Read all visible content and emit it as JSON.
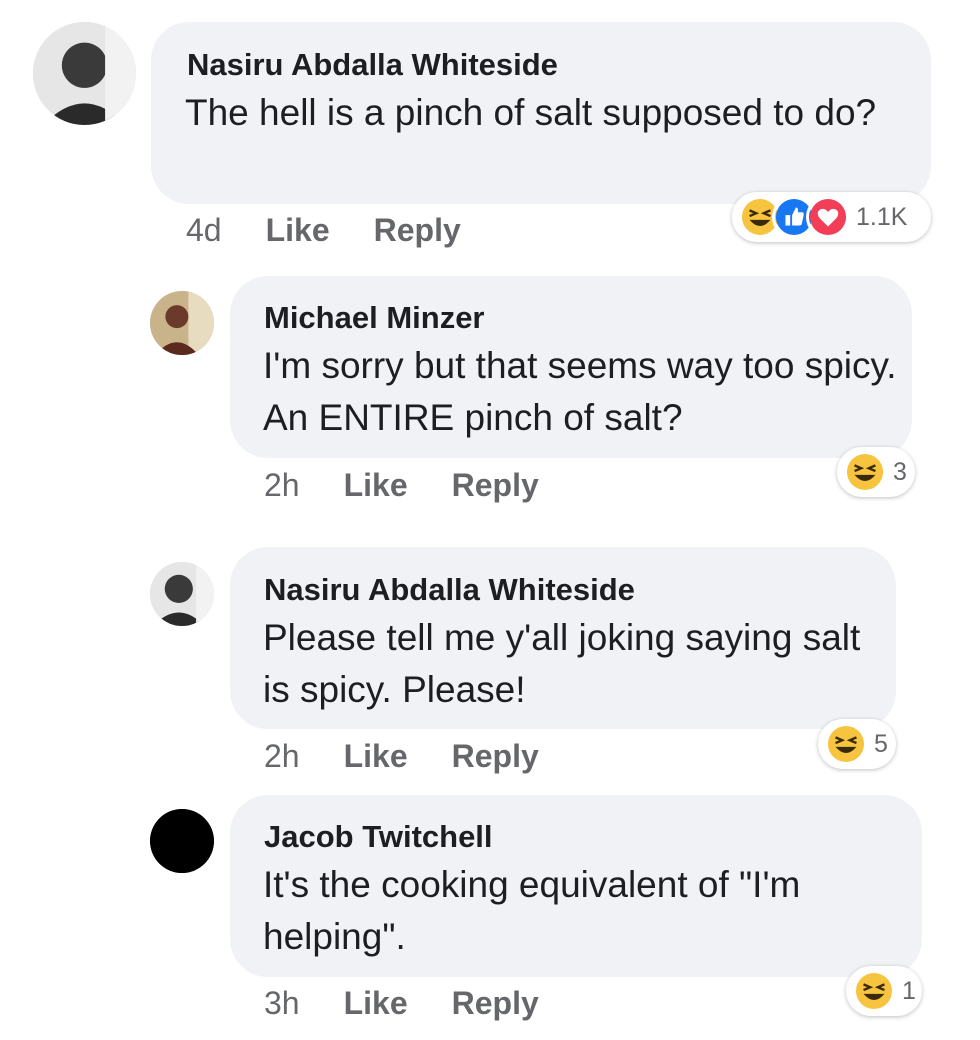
{
  "comments": [
    {
      "author": "Nasiru Abdalla Whiteside",
      "text": "The hell is a pinch of salt supposed to do?",
      "time": "4d",
      "like_label": "Like",
      "reply_label": "Reply",
      "reactions": [
        "haha",
        "like",
        "love"
      ],
      "reaction_count": "1.1K"
    },
    {
      "author": "Michael Minzer",
      "text": "I'm sorry but that seems way too spicy. An ENTIRE pinch of salt?",
      "time": "2h",
      "like_label": "Like",
      "reply_label": "Reply",
      "reactions": [
        "haha"
      ],
      "reaction_count": "3"
    },
    {
      "author": "Nasiru Abdalla Whiteside",
      "text": "Please tell me y'all joking saying salt is spicy. Please!",
      "time": "2h",
      "like_label": "Like",
      "reply_label": "Reply",
      "reactions": [
        "haha"
      ],
      "reaction_count": "5"
    },
    {
      "author": "Jacob Twitchell",
      "text": "It's the cooking equivalent of \"I'm helping\".",
      "time": "3h",
      "like_label": "Like",
      "reply_label": "Reply",
      "reactions": [
        "haha"
      ],
      "reaction_count": "1"
    }
  ],
  "colors": {
    "bubble": "#f0f2f5",
    "meta_text": "#65676b",
    "like_blue": "#1877f2",
    "love_red": "#f33e58",
    "haha_yellow": "#f7c440"
  }
}
